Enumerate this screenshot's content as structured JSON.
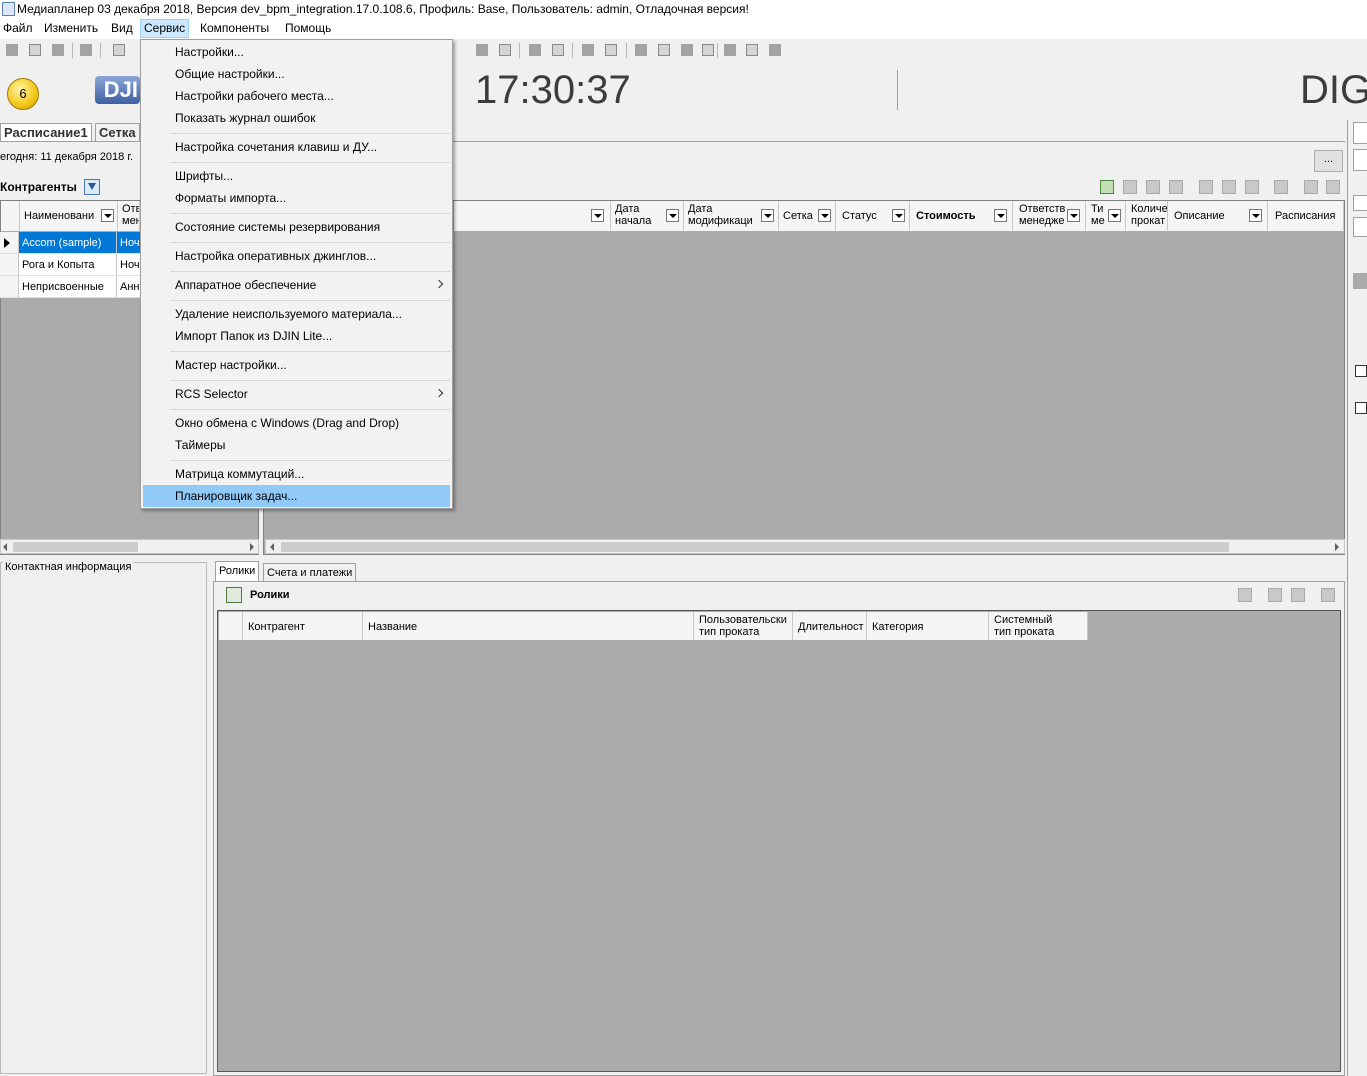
{
  "window": {
    "title": "Медиапланер 03 декабря 2018, Версия dev_bpm_integration.17.0.108.6, Профиль: Base, Пользователь: admin, Отладочная версия!"
  },
  "menubar": {
    "items": [
      "Файл",
      "Изменить",
      "Вид",
      "Сервис",
      "Компоненты",
      "Помощь"
    ],
    "active": "Сервис"
  },
  "header": {
    "badge_count": "6",
    "logo_text": "DJI",
    "clock": "17:30:37",
    "right_text": "DIG"
  },
  "tabs": [
    "Расписание1",
    "Сетка"
  ],
  "today_label": "егодня: 11 декабря 2018 г.",
  "dots_button": "...",
  "contragents": {
    "title": "Контрагенты",
    "columns": [
      "Наименовани",
      "Отв мен"
    ],
    "rows": [
      {
        "name": "Accom (sample)",
        "manager": "Ноч",
        "selected": true
      },
      {
        "name": "Рога и Копыта",
        "manager": "Ноч",
        "selected": false
      },
      {
        "name": "Неприсвоенные",
        "manager": "Анн",
        "selected": false
      }
    ]
  },
  "main_grid": {
    "columns": [
      {
        "label": "Дата начала",
        "lines": [
          "Дата",
          "начала"
        ]
      },
      {
        "label": "Дата модификации",
        "lines": [
          "Дата",
          "модификаци"
        ]
      },
      {
        "label": "Сетка",
        "lines": [
          "Сетка"
        ]
      },
      {
        "label": "Статус",
        "lines": [
          "Статус"
        ]
      },
      {
        "label": "Стоимость",
        "lines": [
          "Стоимость"
        ],
        "bold": true
      },
      {
        "label": "Ответственный менеджер",
        "lines": [
          "Ответств",
          "менедже"
        ]
      },
      {
        "label": "Тип ме",
        "lines": [
          "Ти",
          "ме"
        ]
      },
      {
        "label": "Количество прокатов",
        "lines": [
          "Количе",
          "прокат"
        ]
      },
      {
        "label": "Описание",
        "lines": [
          "Описание"
        ]
      },
      {
        "label": "Расписания",
        "lines": [
          "Расписания"
        ]
      }
    ]
  },
  "contact_info_label": "Контактная информация",
  "bottom_tabs": [
    "Ролики",
    "Счета и платежи"
  ],
  "roliki": {
    "title": "Ролики",
    "columns": [
      {
        "lines": [
          "Контрагент"
        ]
      },
      {
        "lines": [
          "Название"
        ]
      },
      {
        "lines": [
          "Пользовательски",
          "тип проката"
        ]
      },
      {
        "lines": [
          "Длительност"
        ]
      },
      {
        "lines": [
          "Категория"
        ]
      },
      {
        "lines": [
          "Системный",
          "тип проката"
        ]
      }
    ]
  },
  "service_menu": {
    "groups": [
      [
        "Настройки...",
        "Общие настройки...",
        "Настройки рабочего места...",
        "Показать журнал ошибок"
      ],
      [
        "Настройка сочетания клавиш и ДУ..."
      ],
      [
        "Шрифты...",
        "Форматы импорта..."
      ],
      [
        "Состояние системы резервирования"
      ],
      [
        "Настройка оперативных джинглов..."
      ],
      [
        "Аппаратное обеспечение"
      ],
      [
        "Удаление неиспользуемого материала...",
        "Импорт Папок из DJIN Lite..."
      ],
      [
        "Мастер настройки..."
      ],
      [
        "RCS Selector"
      ],
      [
        "Окно обмена с Windows (Drag and Drop)",
        "Таймеры"
      ],
      [
        "Матрица коммутаций...",
        "Планировщик задач..."
      ]
    ],
    "submenu_items": [
      "Аппаратное обеспечение",
      "RCS Selector"
    ],
    "highlighted": "Планировщик задач...",
    "highlight_color": "#91c9f7"
  },
  "colors": {
    "selection": "#0078d7",
    "grid_empty": "#ababab",
    "menu_active": "#cce8ff"
  }
}
